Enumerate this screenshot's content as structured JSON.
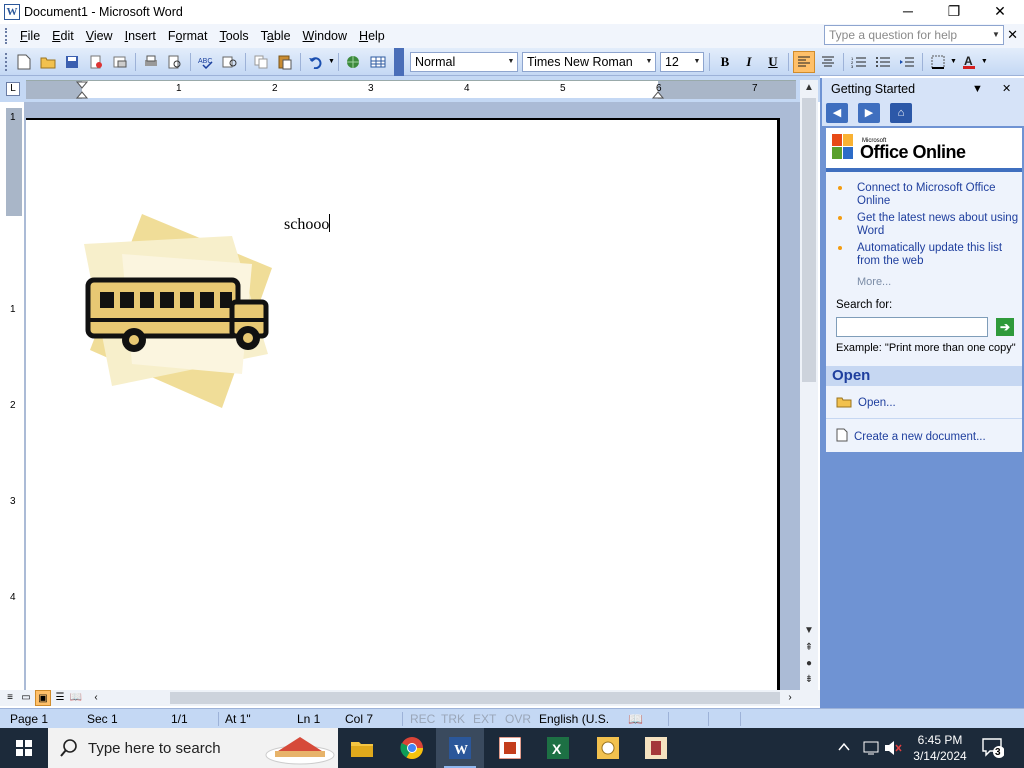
{
  "window": {
    "title": "Document1 - Microsoft Word",
    "controls": {
      "minimize": "─",
      "maximize": "❐",
      "close": "✕"
    }
  },
  "menubar": {
    "items": [
      {
        "key": "F",
        "rest": "ile"
      },
      {
        "key": "E",
        "rest": "dit"
      },
      {
        "key": "V",
        "rest": "iew"
      },
      {
        "key": "I",
        "rest": "nsert"
      },
      {
        "key": "o",
        "pre": "F",
        "rest": "rmat"
      },
      {
        "key": "T",
        "rest": "ools"
      },
      {
        "key": "a",
        "pre": "T",
        "rest": "ble"
      },
      {
        "key": "W",
        "rest": "indow"
      },
      {
        "key": "H",
        "rest": "elp"
      }
    ],
    "help_placeholder": "Type a question for help",
    "close_glyph": "✕"
  },
  "toolbar": {
    "style": "Normal",
    "font": "Times New Roman",
    "size": "12",
    "bold": "B",
    "italic": "I",
    "underline": "U",
    "font_color": "#d42020",
    "highlight_active": "#ffc069"
  },
  "ruler": {
    "h_numbers": [
      "1",
      "2",
      "3",
      "4",
      "5",
      "6",
      "7"
    ],
    "v_numbers": [
      "1",
      "1",
      "2",
      "3",
      "4"
    ],
    "corner": "L"
  },
  "document": {
    "text": "schooo",
    "image": "school-bus-clipart"
  },
  "taskpane": {
    "title": "Getting Started",
    "brand_small": "Microsoft",
    "brand_big": "Office Online",
    "links": [
      "Connect to Microsoft Office Online",
      "Get the latest news about using Word",
      "Automatically update this list from the web"
    ],
    "more": "More...",
    "search_label": "Search for:",
    "example": "Example:  \"Print more than one copy\"",
    "open_section": "Open",
    "open_link": "Open...",
    "new_link": "Create a new document..."
  },
  "statusbar": {
    "page": "Page  1",
    "sec": "Sec  1",
    "pages": "1/1",
    "at": "At  1\"",
    "ln": "Ln  1",
    "col": "Col  7",
    "rec": "REC",
    "trk": "TRK",
    "ext": "EXT",
    "ovr": "OVR",
    "lang": "English (U.S."
  },
  "taskbar": {
    "search_placeholder": "Type here to search",
    "time": "6:45 PM",
    "date": "3/14/2024",
    "notif_count": "3"
  }
}
